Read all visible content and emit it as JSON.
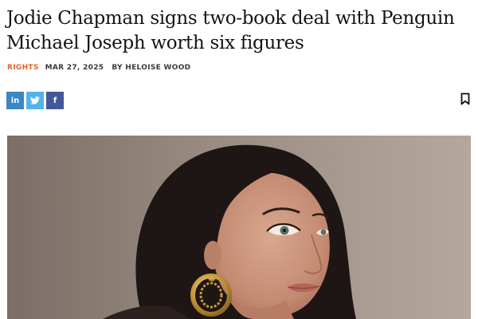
{
  "article": {
    "headline": "Jodie Chapman signs two-book deal with Penguin Michael Joseph worth six figures",
    "category": "RIGHTS",
    "date": "MAR 27, 2025",
    "byline": "BY HELOISE WOOD"
  },
  "share": {
    "linkedin": {
      "icon": "linkedin-icon",
      "label": "in",
      "color": "#3b87c6"
    },
    "twitter": {
      "icon": "twitter-icon",
      "color": "#54b3ea"
    },
    "facebook": {
      "icon": "facebook-icon",
      "label": "f",
      "color": "#44579b"
    }
  },
  "bookmark": {
    "icon": "bookmark-icon"
  },
  "colors": {
    "category_accent": "#e0622d",
    "text": "#141414"
  }
}
